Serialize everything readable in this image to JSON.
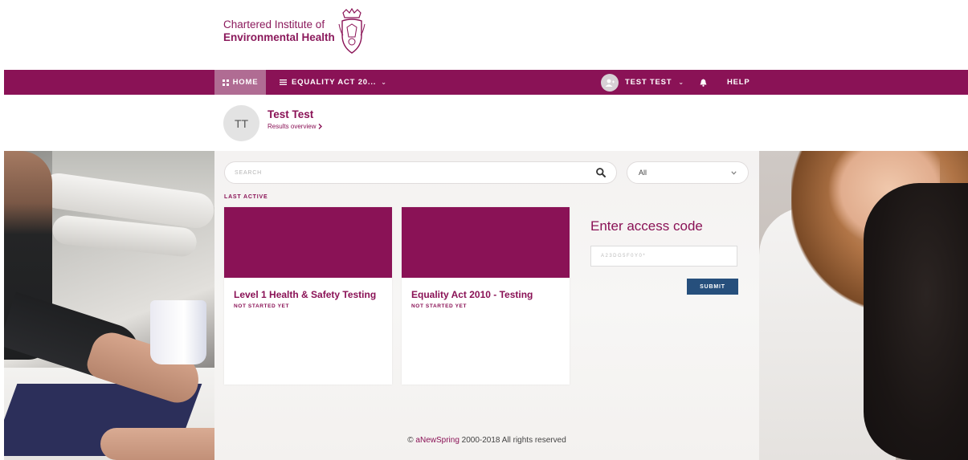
{
  "logo": {
    "line1": "Chartered Institute of",
    "line2": "Environmental Health"
  },
  "nav": {
    "home": "HOME",
    "menu": "EQUALITY ACT 20...",
    "user": "TEST TEST",
    "help": "HELP"
  },
  "profile": {
    "initials": "TT",
    "name": "Test Test",
    "link": "Results overview"
  },
  "search": {
    "placeholder": "SEARCH"
  },
  "filter": {
    "value": "All"
  },
  "section": {
    "last_active": "LAST ACTIVE"
  },
  "cards": [
    {
      "title": "Level 1 Health & Safety Testing",
      "status": "NOT STARTED YET"
    },
    {
      "title": "Equality Act 2010 - Testing",
      "status": "NOT STARTED YET"
    }
  ],
  "access": {
    "title": "Enter access code",
    "placeholder": "A23DG5F0Y0*",
    "submit": "SUBMIT"
  },
  "footer": {
    "copy": "©",
    "brand": "aNewSpring",
    "rest": "2000-2018 All rights reserved"
  },
  "colors": {
    "brand": "#8a1256",
    "nav_active": "#b06c93",
    "submit": "#264f7c"
  },
  "icons": {
    "home": "grid-icon",
    "menu": "hamburger-icon",
    "search": "search-icon",
    "bell": "bell-icon",
    "avatar": "user-add-icon",
    "chevron": "chevron-down-icon",
    "arrow": "chevron-right-icon"
  }
}
